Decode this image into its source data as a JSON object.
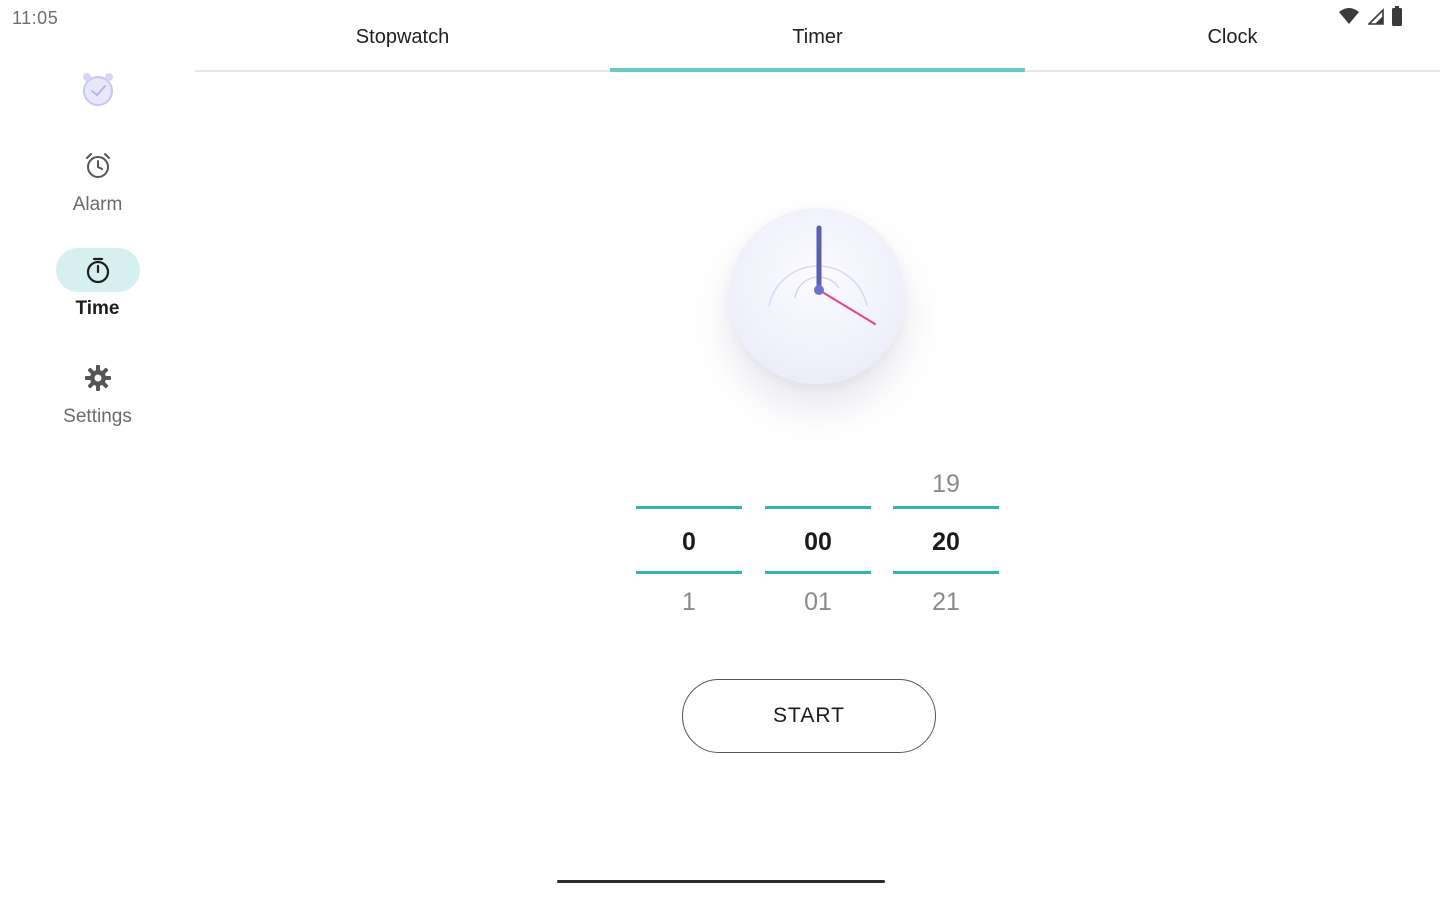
{
  "status_bar": {
    "time": "11:05",
    "icons": [
      "wifi-icon",
      "cell-signal-icon",
      "battery-icon"
    ]
  },
  "rail": {
    "logo_icon": "app-alarm-logo-icon",
    "items": [
      {
        "label": "Alarm",
        "icon": "alarm-clock-icon",
        "active": false
      },
      {
        "label": "Time",
        "icon": "stopwatch-icon",
        "active": true
      },
      {
        "label": "Settings",
        "icon": "gear-icon",
        "active": false
      }
    ]
  },
  "tabs": [
    {
      "label": "Stopwatch",
      "active": false
    },
    {
      "label": "Timer",
      "active": true
    },
    {
      "label": "Clock",
      "active": false
    }
  ],
  "picker": {
    "hours": {
      "above": "",
      "current": "0",
      "below": "1"
    },
    "minutes": {
      "above": "",
      "current": "00",
      "below": "01"
    },
    "seconds": {
      "above": "19",
      "current": "20",
      "below": "21"
    }
  },
  "start_label": "START",
  "colors": {
    "accent": "#2fb3b8",
    "active_pill": "#d6f0f1",
    "tab_indicator": "#6cc9c9",
    "clock_hand": "#5a5fae",
    "second_hand": "#e8467a"
  }
}
